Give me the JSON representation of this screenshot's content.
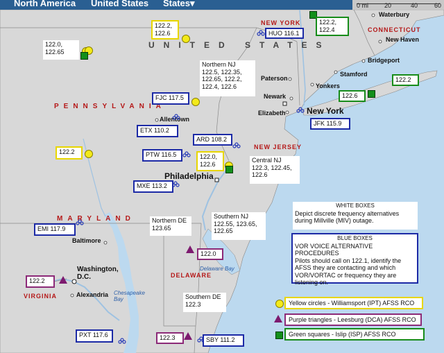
{
  "nav": {
    "items": [
      "North America",
      "United States",
      "States▾"
    ]
  },
  "scale": {
    "labels": [
      "0 mi",
      "20",
      "40",
      "60"
    ]
  },
  "country_label": "UNITED STATES",
  "states": [
    "NEW YORK",
    "CONNECTICUT",
    "PENNSYLVANIA",
    "NEW JERSEY",
    "MARYLAND",
    "DELAWARE",
    "VIRGINIA"
  ],
  "cities": [
    "Waterbury",
    "New Haven",
    "Bridgeport",
    "Stamford",
    "Yonkers",
    "Paterson",
    "Newark",
    "Elizabeth",
    "New York",
    "Allentown",
    "Philadelphia",
    "Baltimore",
    "Washington, D.C.",
    "Alexandria"
  ],
  "water": [
    "Delaware Bay",
    "Chesapeake Bay"
  ],
  "boxes": {
    "huo": "HUO 116.1",
    "ny_green": "122.2,\n122.4",
    "ct_green": "122.2",
    "ny_green2": "122.6",
    "jfk": "JFK 115.9",
    "nw_yellow": "122.0,\n122.65",
    "mid_yellow": "122.2,\n122.6",
    "northern_nj": "Northern NJ\n122.5, 122.35,\n122.65, 122.2,\n122.4, 122.6",
    "fjc": "FJC 117.5",
    "etx": "ETX 110.2",
    "ard": "ARD 108.2",
    "ptw": "PTW 116.5",
    "phl_yellow": "122.0,\n122.6",
    "central_nj": "Central NJ\n122.3, 122.45,\n122.6",
    "allentown_yellow": "122.2",
    "mxe": "MXE 113.2",
    "emi": "EMI 117.9",
    "northern_de": "Northern DE\n123.65",
    "southern_nj": "Southern NJ\n122.55, 123.65,\n122.65",
    "de_purple": "122.0",
    "dca_purple": "122.2",
    "southern_de": "Southern DE\n122.3",
    "pxt": "PXT 117.6",
    "sby_purple": "122.3",
    "sby": "SBY 111.2"
  },
  "white_note": {
    "title": "WHITE BOXES",
    "text": "Depict discrete frequency alternatives\nduring Millville (MIV) outage."
  },
  "blue_note": {
    "title": "BLUE BOXES",
    "text": "VOR VOICE ALTERNATIVE PROCEDURES\nPilots should call on 122.1, identify the\nAFSS they are contacting and which\nVOR/VORTAC or frequency they are\nlistening on."
  },
  "legend": {
    "yellow": "Yellow circles - Williamsport (IPT) AFSS RCO",
    "purple": "Purple triangles - Leesburg (DCA) AFSS RCO",
    "green": "Green squares - Islip (ISP) AFSS RCO"
  },
  "colors": {
    "land_us": "#d8d8d8",
    "water": "#bcd9ef",
    "blue": "#1c2aa6",
    "yellow": "#e8d600",
    "green": "#178c1a",
    "purple": "#8c2a78",
    "state_label": "#b51818"
  },
  "icons": {
    "vor": "vor-station-icon",
    "rco_yellow": "yellow-circle-icon",
    "rco_purple": "purple-triangle-icon",
    "rco_green": "green-square-icon"
  }
}
